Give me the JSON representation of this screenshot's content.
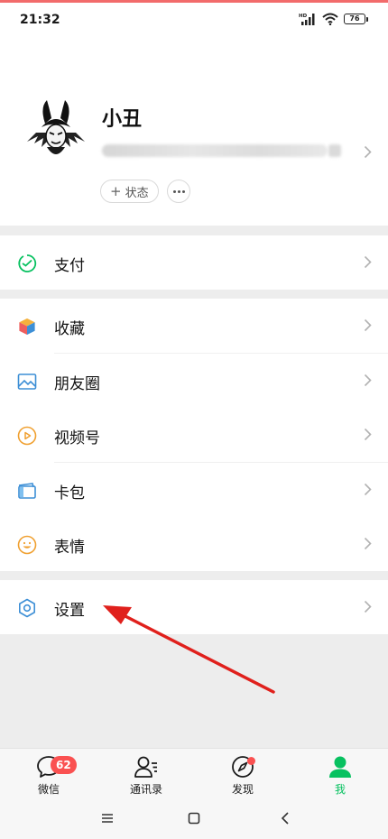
{
  "status_bar": {
    "time": "21:32",
    "network_icon": "hd-signal-icon",
    "wifi_icon": "wifi-icon",
    "battery_level": "76"
  },
  "profile": {
    "name": "小丑",
    "status_button_label": "状态",
    "more_icon": "ellipsis-icon"
  },
  "menu": {
    "pay": {
      "label": "支付",
      "icon": "pay-icon",
      "color": "#07c160"
    },
    "favorites": {
      "label": "收藏",
      "icon": "cube-icon"
    },
    "moments": {
      "label": "朋友圈",
      "icon": "image-icon",
      "color": "#3d8fd6"
    },
    "channels": {
      "label": "视频号",
      "icon": "play-circle-icon",
      "color": "#f0a030"
    },
    "cards": {
      "label": "卡包",
      "icon": "card-icon",
      "color": "#3d8fd6"
    },
    "stickers": {
      "label": "表情",
      "icon": "smile-icon",
      "color": "#f0a030"
    },
    "settings": {
      "label": "设置",
      "icon": "gear-icon",
      "color": "#3d8fd6"
    }
  },
  "tab_bar": {
    "chats": {
      "label": "微信",
      "badge": "62",
      "icon": "chat-icon"
    },
    "contacts": {
      "label": "通讯录",
      "icon": "contacts-icon"
    },
    "discover": {
      "label": "发现",
      "icon": "compass-icon"
    },
    "me": {
      "label": "我",
      "icon": "person-icon",
      "color": "#07c160"
    }
  },
  "system_nav": {
    "menu_icon": "menu-icon",
    "home_icon": "home-square-icon",
    "back_icon": "back-icon"
  },
  "annotation": {
    "arrow_color": "#e0201c"
  }
}
